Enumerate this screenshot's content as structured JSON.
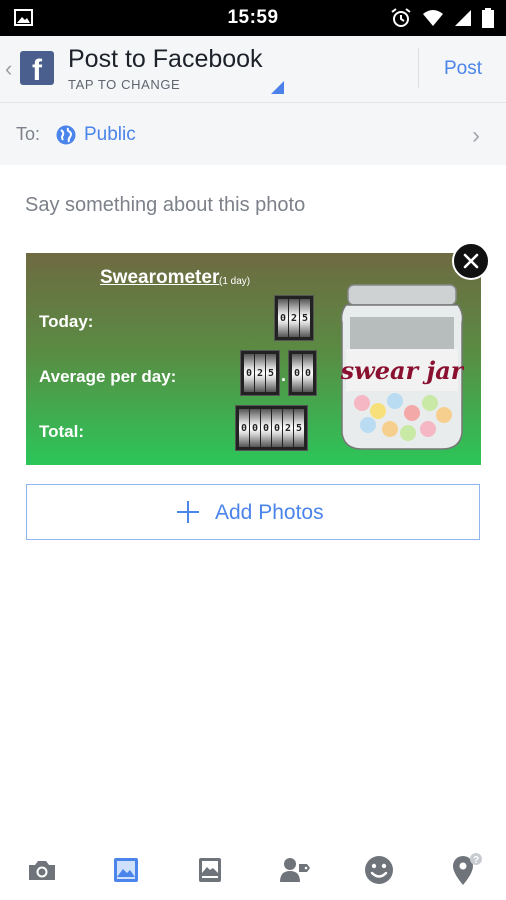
{
  "status_bar": {
    "time": "15:59"
  },
  "header": {
    "title": "Post to Facebook",
    "subtitle": "TAP TO CHANGE",
    "post_label": "Post"
  },
  "audience": {
    "to_label": "To:",
    "value": "Public"
  },
  "composer": {
    "placeholder": "Say something about this photo"
  },
  "photo": {
    "title": "Swearometer",
    "period": "(1 day)",
    "rows": [
      {
        "label": "Today:",
        "digits": [
          "0",
          "2",
          "5"
        ]
      },
      {
        "label": "Average per day:",
        "digits": [
          "0",
          "2",
          "5"
        ],
        "decimals": [
          "0",
          "0"
        ]
      },
      {
        "label": "Total:",
        "digits": [
          "0",
          "0",
          "0",
          "0",
          "2",
          "5"
        ]
      }
    ],
    "jar_text": "swear jar"
  },
  "add_photos": {
    "label": "Add Photos"
  },
  "toolbar": {
    "items": [
      "camera-icon",
      "photo-icon",
      "album-icon",
      "tag-people-icon",
      "feeling-icon",
      "location-icon"
    ]
  },
  "colors": {
    "accent": "#4b84ea",
    "facebook": "#4a5f8e"
  }
}
